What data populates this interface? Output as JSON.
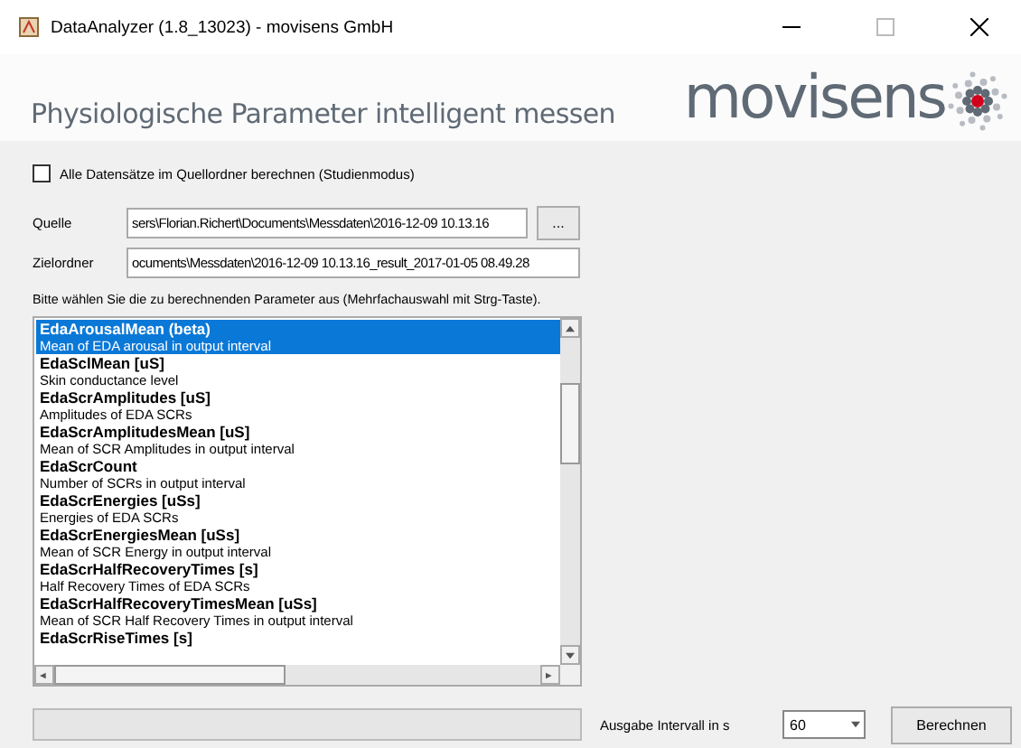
{
  "window": {
    "title": "DataAnalyzer (1.8_13023) - movisens GmbH"
  },
  "header": {
    "headline": "Physiologische Parameter intelligent messen",
    "logo": "movisens"
  },
  "study_mode": {
    "label": "Alle Datensätze im Quellordner berechnen (Studienmodus)",
    "checked": false
  },
  "source": {
    "label": "Quelle",
    "value": "sers\\Florian.Richert\\Documents\\Messdaten\\2016-12-09 10.13.16",
    "browse": "..."
  },
  "target": {
    "label": "Zielordner",
    "value": "ocuments\\Messdaten\\2016-12-09 10.13.16_result_2017-01-05 08.49.28"
  },
  "hint": "Bitte wählen Sie die zu berechnenden Parameter aus (Mehrfachauswahl mit Strg-Taste).",
  "parameters": [
    {
      "name": "EdaArousalMean (beta)",
      "description": "Mean of EDA arousal in output interval",
      "selected": true
    },
    {
      "name": "EdaSclMean [uS]",
      "description": "Skin conductance level",
      "selected": false
    },
    {
      "name": "EdaScrAmplitudes [uS]",
      "description": "Amplitudes of EDA SCRs",
      "selected": false
    },
    {
      "name": "EdaScrAmplitudesMean [uS]",
      "description": "Mean of SCR Amplitudes in output interval",
      "selected": false
    },
    {
      "name": "EdaScrCount",
      "description": "Number of SCRs in output interval",
      "selected": false
    },
    {
      "name": "EdaScrEnergies [uSs]",
      "description": "Energies of EDA SCRs",
      "selected": false
    },
    {
      "name": "EdaScrEnergiesMean [uSs]",
      "description": "Mean of SCR Energy in output interval",
      "selected": false
    },
    {
      "name": "EdaScrHalfRecoveryTimes [s]",
      "description": "Half Recovery Times of EDA SCRs",
      "selected": false
    },
    {
      "name": "EdaScrHalfRecoveryTimesMean [uSs]",
      "description": "Mean of SCR Half Recovery Times in output interval",
      "selected": false
    },
    {
      "name": "EdaScrRiseTimes [s]",
      "selected": false
    }
  ],
  "interval": {
    "label": "Ausgabe Intervall in s",
    "value": "60"
  },
  "calculate_button": "Berechnen"
}
